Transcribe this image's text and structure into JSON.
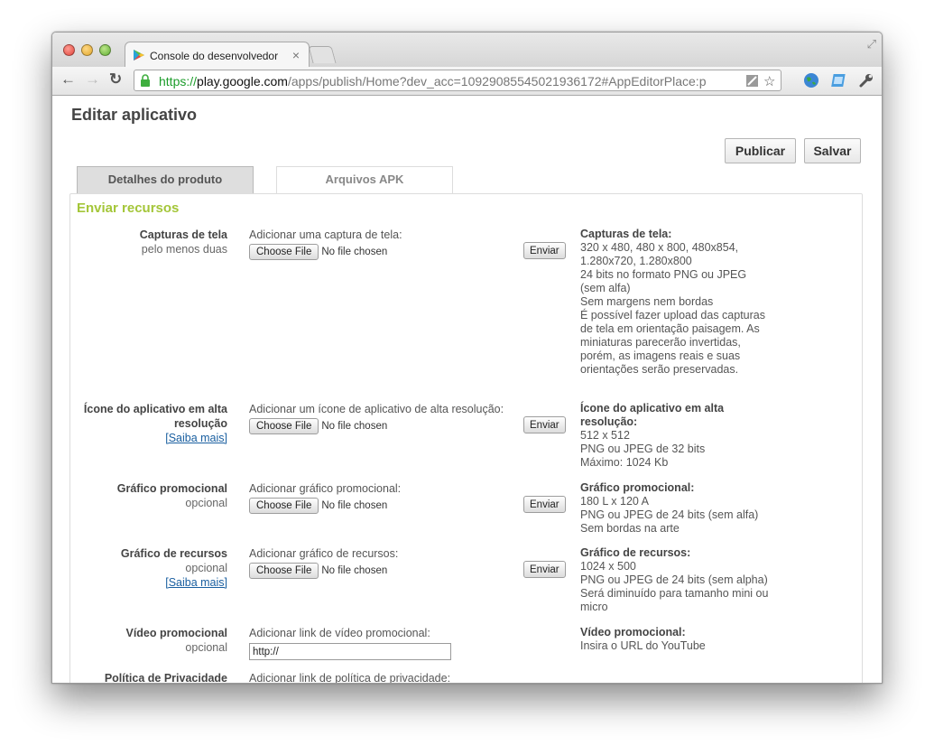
{
  "browser": {
    "tab_title": "Console do desenvolvedor",
    "tab_close": "×",
    "url_scheme": "https://",
    "url_host": "play.google.com",
    "url_path": "/apps/publish/Home?dev_acc=10929085545021936172#AppEditorPlace:p",
    "accent_color": "#1b9c2a"
  },
  "page": {
    "title": "Editar aplicativo",
    "publish_label": "Publicar",
    "save_label": "Salvar",
    "tabs": [
      {
        "label": "Detalhes do produto",
        "active": true
      },
      {
        "label": "Arquivos APK",
        "active": false
      }
    ],
    "section_title": "Enviar recursos",
    "section_color": "#a4c639"
  },
  "rows": [
    {
      "label": "Capturas de tela",
      "sub": "pelo menos duas",
      "field_label": "Adicionar uma captura de tela:",
      "choose_file": "Choose File",
      "no_file": "No file chosen",
      "send": "Enviar",
      "info_title": "Capturas de tela:",
      "info_lines": [
        "320 x 480, 480 x 800, 480x854,",
        "1.280x720, 1.280x800",
        "24 bits no formato PNG ou JPEG",
        "(sem alfa)",
        "Sem margens nem bordas",
        "É possível fazer upload das capturas",
        "de tela em orientação paisagem. As",
        "miniaturas parecerão invertidas,",
        "porém, as imagens reais e suas",
        "orientações serão preservadas."
      ]
    },
    {
      "label_line1": "Ícone do aplicativo em alta",
      "label_line2": "resolução",
      "link": "[Saiba mais]",
      "field_label": "Adicionar um ícone de aplicativo de alta resolução:",
      "choose_file": "Choose File",
      "no_file": "No file chosen",
      "send": "Enviar",
      "info_title_line1": "Ícone do aplicativo em alta",
      "info_title_line2": "resolução:",
      "info_lines": [
        "512 x 512",
        "PNG ou JPEG de 32 bits",
        "Máximo: 1024 Kb"
      ]
    },
    {
      "label": "Gráfico promocional",
      "sub": "opcional",
      "field_label": "Adicionar gráfico promocional:",
      "choose_file": "Choose File",
      "no_file": "No file chosen",
      "send": "Enviar",
      "info_title": "Gráfico promocional:",
      "info_lines": [
        "180 L x 120 A",
        "PNG ou JPEG de 24 bits (sem alfa)",
        "Sem bordas na arte"
      ]
    },
    {
      "label": "Gráfico de recursos",
      "sub": "opcional",
      "link": "[Saiba mais]",
      "field_label": "Adicionar gráfico de recursos:",
      "choose_file": "Choose File",
      "no_file": "No file chosen",
      "send": "Enviar",
      "info_title": "Gráfico de recursos:",
      "info_lines": [
        "1024 x 500",
        "PNG ou JPEG de 24 bits (sem alpha)",
        "Será diminuído para tamanho mini ou",
        "micro"
      ]
    },
    {
      "label": "Vídeo promocional",
      "sub": "opcional",
      "field_label": "Adicionar link de vídeo promocional:",
      "input_value": "http://",
      "info_title": "Vídeo promocional:",
      "info_lines": [
        "Insira o URL do YouTube"
      ]
    },
    {
      "label": "Política de Privacidade",
      "field_label": "Adicionar link de política de privacidade:"
    }
  ]
}
